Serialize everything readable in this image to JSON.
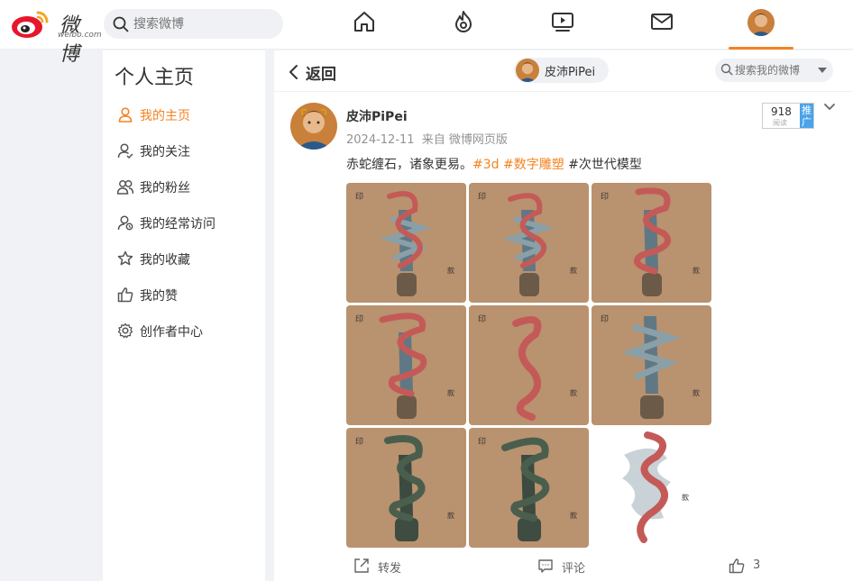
{
  "app": {
    "logo_text": "微博",
    "logo_sub": "weibo.com",
    "search_placeholder": "搜索微博"
  },
  "nav": {
    "icons": [
      "home-icon",
      "hot-icon",
      "video-icon",
      "message-icon"
    ],
    "accent": "#f58220"
  },
  "sidebar": {
    "title": "个人主页",
    "items": [
      {
        "label": "我的主页",
        "icon": "person-icon",
        "active": true
      },
      {
        "label": "我的关注",
        "icon": "follow-icon",
        "active": false
      },
      {
        "label": "我的粉丝",
        "icon": "fans-icon",
        "active": false
      },
      {
        "label": "我的经常访问",
        "icon": "frequent-visit-icon",
        "active": false
      },
      {
        "label": "我的收藏",
        "icon": "star-icon",
        "active": false
      },
      {
        "label": "我的赞",
        "icon": "thumbs-up-icon",
        "active": false
      },
      {
        "label": "创作者中心",
        "icon": "gear-icon",
        "active": false
      }
    ]
  },
  "header": {
    "back_label": "返回",
    "user_name": "皮沛PiPei",
    "search_placeholder": "搜索我的微博"
  },
  "post": {
    "author": "皮沛PiPei",
    "date": "2024-12-11",
    "source": "来自 微博网页版",
    "text_main": "赤蛇缠石，诸象更易。",
    "tag1": "#3d",
    "tag2": "#数字雕塑",
    "tag3": "#次世代模型",
    "reads": "918",
    "reads_label": "阅读",
    "promote_label": "推广",
    "image_count": 9,
    "actions": {
      "repost": "转发",
      "comment": "评论",
      "likes": "3"
    }
  }
}
